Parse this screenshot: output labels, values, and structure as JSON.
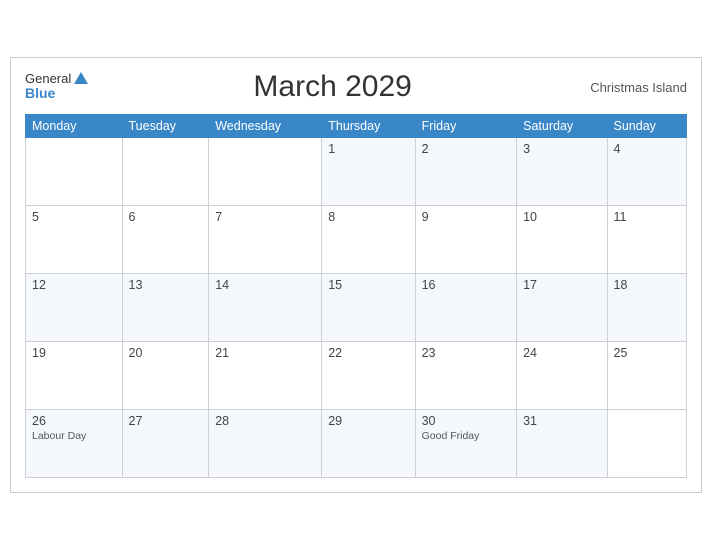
{
  "header": {
    "logo_general": "General",
    "logo_blue": "Blue",
    "title": "March 2029",
    "region": "Christmas Island"
  },
  "weekdays": [
    "Monday",
    "Tuesday",
    "Wednesday",
    "Thursday",
    "Friday",
    "Saturday",
    "Sunday"
  ],
  "weeks": [
    [
      {
        "day": "",
        "event": ""
      },
      {
        "day": "",
        "event": ""
      },
      {
        "day": "",
        "event": ""
      },
      {
        "day": "1",
        "event": ""
      },
      {
        "day": "2",
        "event": ""
      },
      {
        "day": "3",
        "event": ""
      },
      {
        "day": "4",
        "event": ""
      }
    ],
    [
      {
        "day": "5",
        "event": ""
      },
      {
        "day": "6",
        "event": ""
      },
      {
        "day": "7",
        "event": ""
      },
      {
        "day": "8",
        "event": ""
      },
      {
        "day": "9",
        "event": ""
      },
      {
        "day": "10",
        "event": ""
      },
      {
        "day": "11",
        "event": ""
      }
    ],
    [
      {
        "day": "12",
        "event": ""
      },
      {
        "day": "13",
        "event": ""
      },
      {
        "day": "14",
        "event": ""
      },
      {
        "day": "15",
        "event": ""
      },
      {
        "day": "16",
        "event": ""
      },
      {
        "day": "17",
        "event": ""
      },
      {
        "day": "18",
        "event": ""
      }
    ],
    [
      {
        "day": "19",
        "event": ""
      },
      {
        "day": "20",
        "event": ""
      },
      {
        "day": "21",
        "event": ""
      },
      {
        "day": "22",
        "event": ""
      },
      {
        "day": "23",
        "event": ""
      },
      {
        "day": "24",
        "event": ""
      },
      {
        "day": "25",
        "event": ""
      }
    ],
    [
      {
        "day": "26",
        "event": "Labour Day"
      },
      {
        "day": "27",
        "event": ""
      },
      {
        "day": "28",
        "event": ""
      },
      {
        "day": "29",
        "event": ""
      },
      {
        "day": "30",
        "event": "Good Friday"
      },
      {
        "day": "31",
        "event": ""
      },
      {
        "day": "",
        "event": ""
      }
    ]
  ]
}
